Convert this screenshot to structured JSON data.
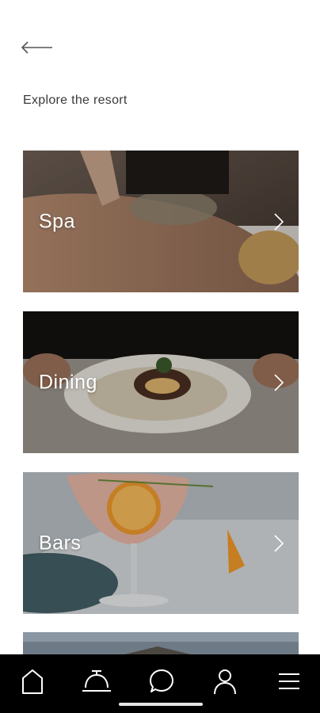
{
  "header": {
    "back_icon": "arrow-left-icon",
    "title": "Explore the resort"
  },
  "cards": [
    {
      "label": "Spa",
      "chevron_icon": "chevron-right-icon"
    },
    {
      "label": "Dining",
      "chevron_icon": "chevron-right-icon"
    },
    {
      "label": "Bars",
      "chevron_icon": "chevron-right-icon"
    }
  ],
  "bottom_nav": [
    {
      "icon": "home-icon"
    },
    {
      "icon": "concierge-bell-icon"
    },
    {
      "icon": "chat-icon"
    },
    {
      "icon": "profile-icon"
    },
    {
      "icon": "menu-icon"
    }
  ],
  "colors": {
    "background": "#ffffff",
    "text": "#3a3a3a",
    "nav_background": "#000000",
    "nav_icon": "#ffffff"
  }
}
